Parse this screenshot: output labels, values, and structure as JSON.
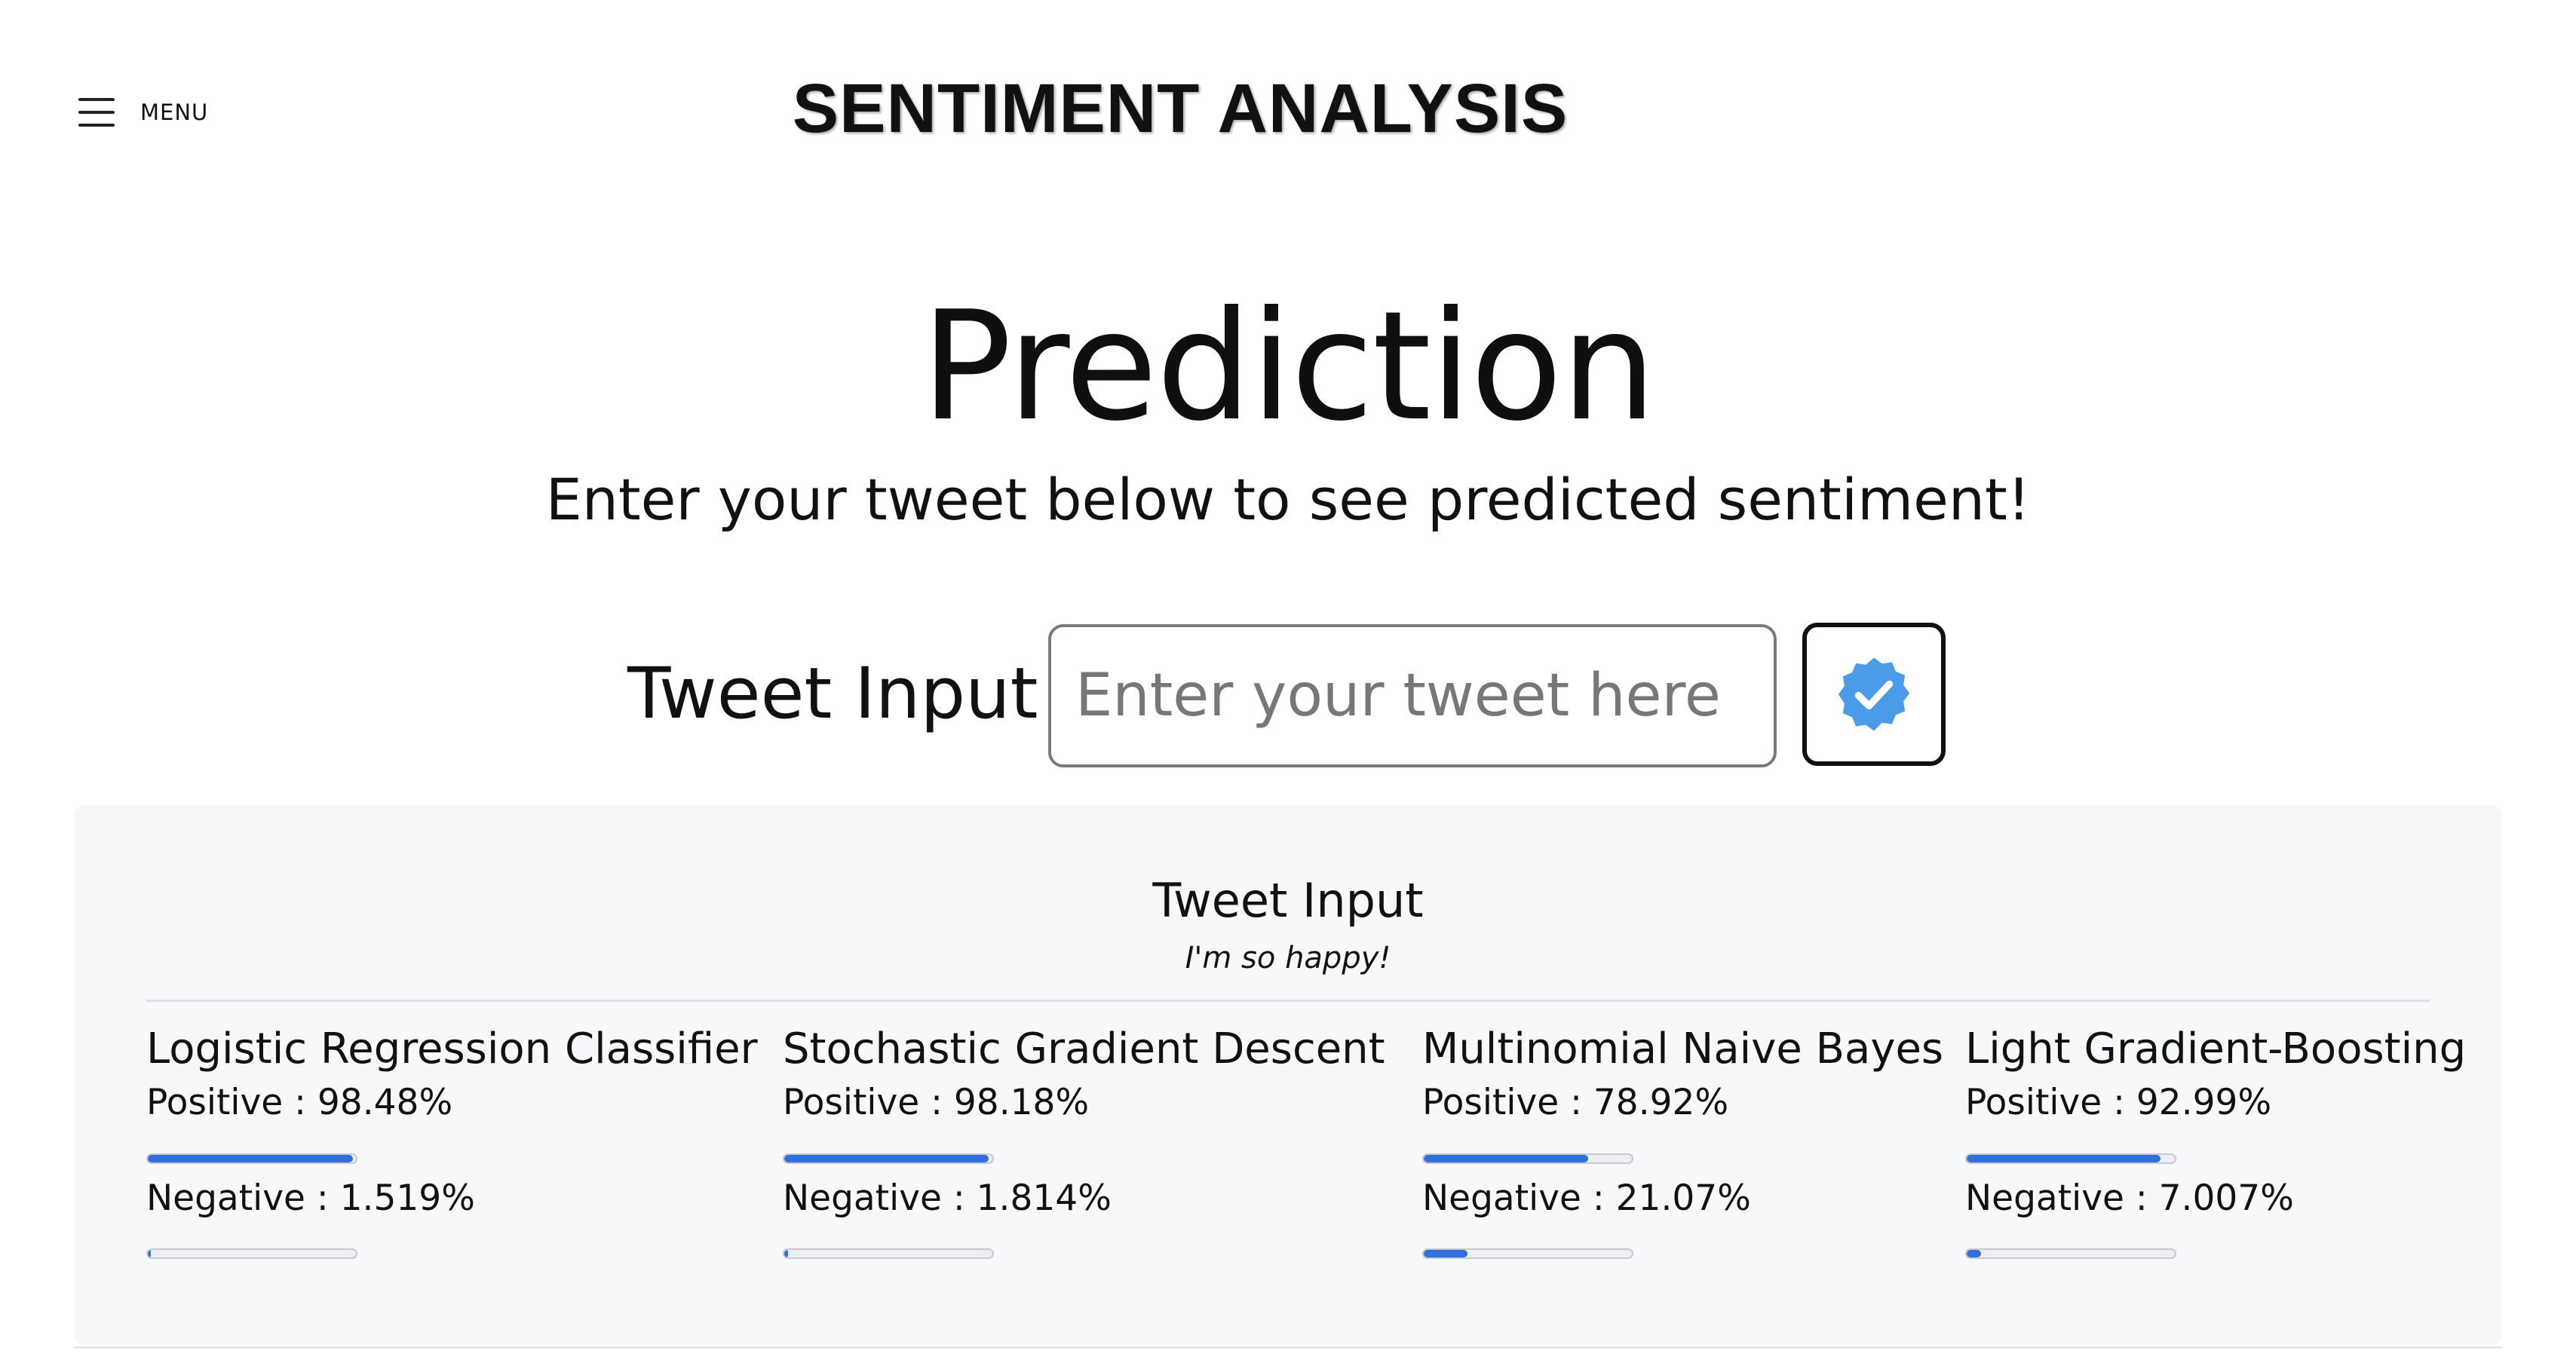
{
  "header": {
    "menu_label": "MENU",
    "brand": "SENTIMENT ANALYSIS"
  },
  "hero": {
    "title": "Prediction",
    "subtitle": "Enter your tweet below to see predicted sentiment!"
  },
  "form": {
    "label": "Tweet Input",
    "placeholder": "Enter your tweet here",
    "value": "",
    "submit_icon": "verified-check-badge-icon"
  },
  "results": {
    "title": "Tweet Input",
    "tweet": "I'm so happy!",
    "models": [
      {
        "name": "Logistic Regression Classifier",
        "positive_text": "Positive : 98.48%",
        "negative_text": "Negative : 1.519%",
        "positive": 98.48,
        "negative": 1.519
      },
      {
        "name": "Stochastic Gradient Descent",
        "positive_text": "Positive : 98.18%",
        "negative_text": "Negative : 1.814%",
        "positive": 98.18,
        "negative": 1.814
      },
      {
        "name": "Multinomial Naive Bayes",
        "positive_text": "Positive : 78.92%",
        "negative_text": "Negative : 21.07%",
        "positive": 78.92,
        "negative": 21.07
      },
      {
        "name": "Light Gradient-Boosting",
        "positive_text": "Positive : 92.99%",
        "negative_text": "Negative : 7.007%",
        "positive": 92.99,
        "negative": 7.007
      }
    ]
  },
  "colors": {
    "accent": "#2f6fde",
    "badge": "#4a9be8",
    "panel_bg": "#f7f8fa"
  }
}
